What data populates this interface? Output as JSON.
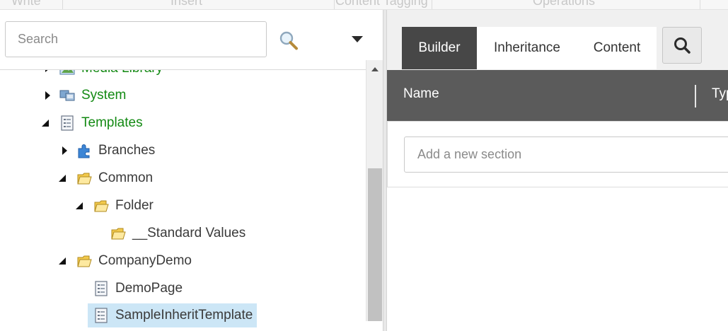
{
  "ribbon": {
    "tabs": [
      "Write",
      "Insert",
      "Content Tagging",
      "Operations"
    ]
  },
  "search": {
    "placeholder": "Search",
    "search_icon": "magnifier-icon",
    "dropdown_icon": "caret-down-icon"
  },
  "tree": {
    "items": [
      {
        "label": "Media Library",
        "icon": "media-library-icon",
        "state": "collapsed",
        "color": "#138a13"
      },
      {
        "label": "System",
        "icon": "system-icon",
        "state": "collapsed",
        "color": "#138a13"
      },
      {
        "label": "Templates",
        "icon": "template-icon",
        "state": "expanded",
        "color": "#138a13"
      },
      {
        "label": "Branches",
        "icon": "branch-puzzle-icon",
        "state": "collapsed"
      },
      {
        "label": "Common",
        "icon": "folder-icon",
        "state": "expanded"
      },
      {
        "label": "Folder",
        "icon": "folder-icon",
        "state": "expanded"
      },
      {
        "label": "__Standard Values",
        "icon": "folder-icon",
        "state": "leaf"
      },
      {
        "label": "CompanyDemo",
        "icon": "folder-icon",
        "state": "expanded"
      },
      {
        "label": "DemoPage",
        "icon": "template-icon",
        "state": "leaf"
      },
      {
        "label": "SampleInheritTemplate",
        "icon": "template-icon",
        "state": "leaf",
        "selected": true
      }
    ]
  },
  "editor": {
    "tabs": [
      {
        "label": "Builder",
        "active": true
      },
      {
        "label": "Inheritance",
        "active": false
      },
      {
        "label": "Content",
        "active": false
      }
    ],
    "search_button_icon": "search-icon",
    "grid_header": {
      "name": "Name",
      "type": "Typ"
    },
    "add_section_placeholder": "Add a new section"
  },
  "colors": {
    "active_tab": "#474747",
    "grid_header_bg": "#5b5b5b",
    "selection_bg": "#cce6f6",
    "item_green": "#138a13"
  }
}
